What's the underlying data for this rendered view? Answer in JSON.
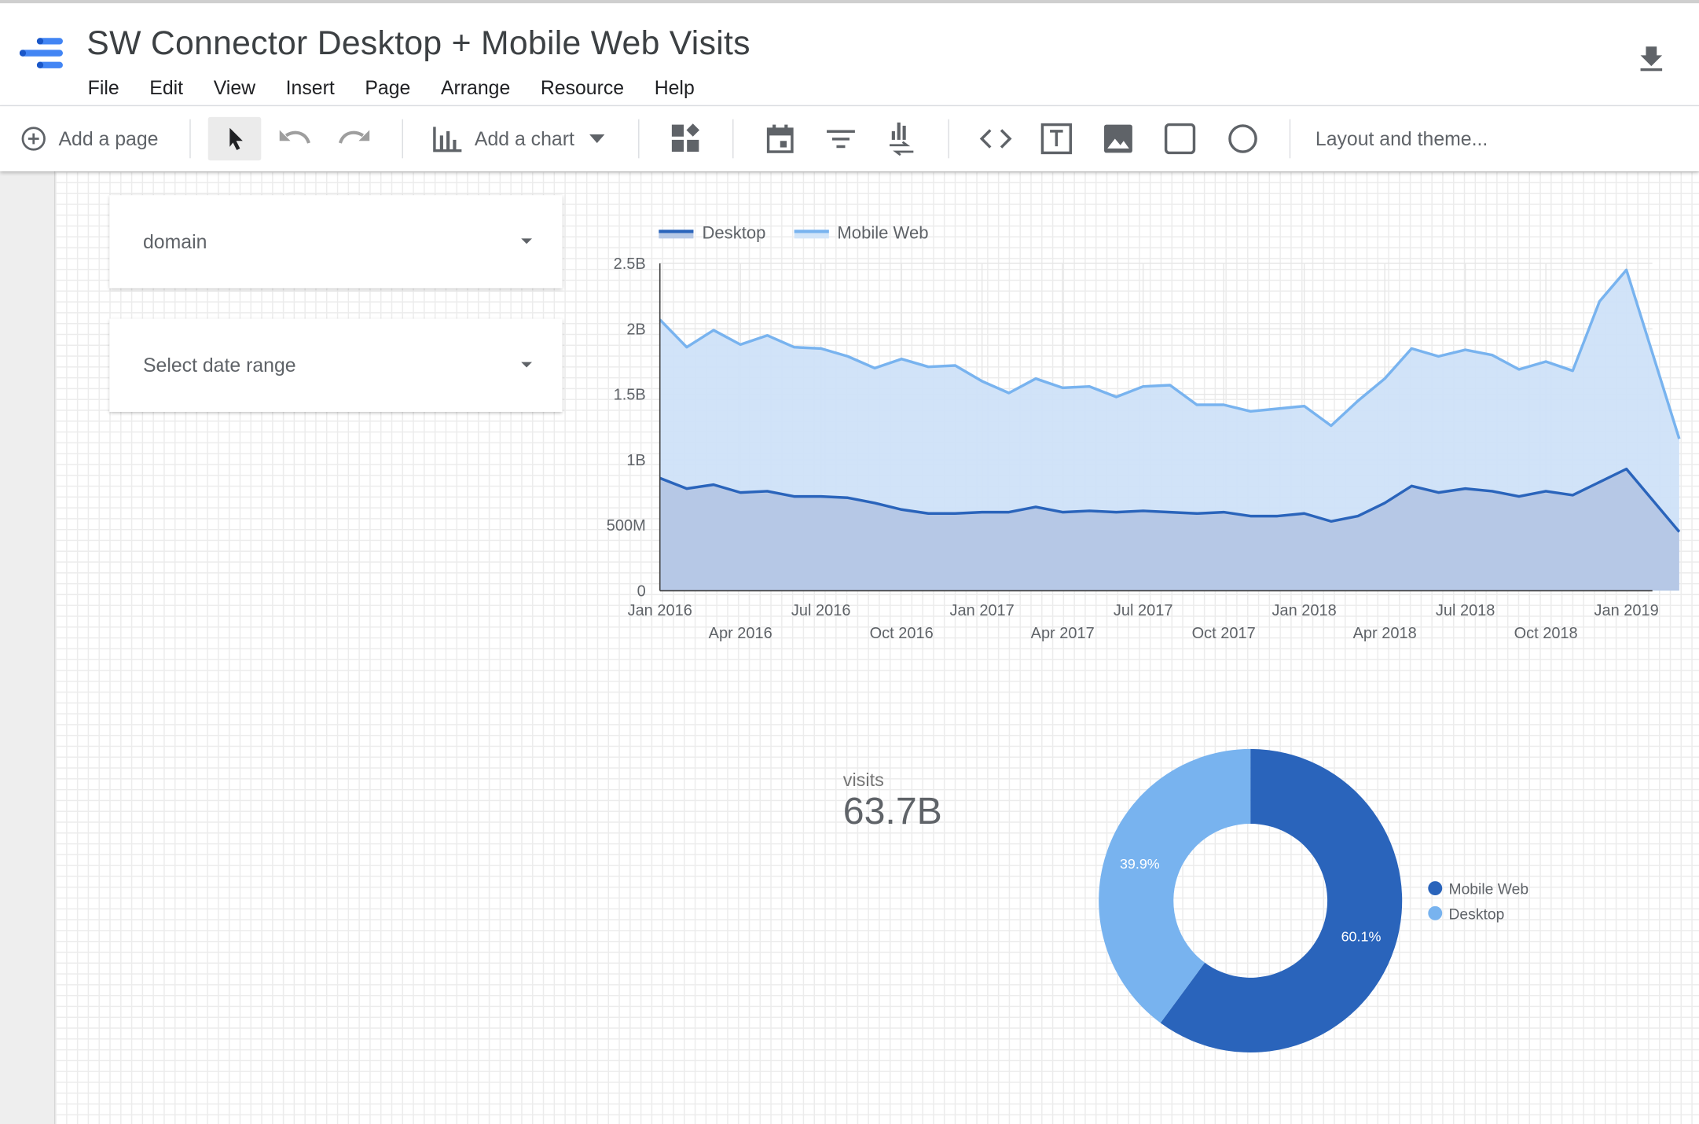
{
  "app": {
    "title": "SW Connector Desktop + Mobile Web Visits",
    "menu": [
      "File",
      "Edit",
      "View",
      "Insert",
      "Page",
      "Arrange",
      "Resource",
      "Help"
    ],
    "download_icon": "download-icon"
  },
  "toolbar": {
    "add_page_label": "Add a page",
    "add_chart_label": "Add a chart",
    "layout_theme_label": "Layout and theme...",
    "icons": [
      "add-circle-icon",
      "pointer-icon",
      "undo-icon",
      "redo-icon",
      "bar-chart-icon",
      "dropdown-arrow-icon",
      "community-viz-icon",
      "date-range-icon",
      "filter-control-icon",
      "data-control-icon",
      "embed-code-icon",
      "text-box-icon",
      "image-icon",
      "rectangle-icon",
      "circle-icon"
    ]
  },
  "controls": {
    "dimension_label": "domain",
    "date_range_label": "Select date range"
  },
  "scorecard": {
    "label": "visits",
    "value": "63.7B"
  },
  "colors": {
    "desktop": "#2a64bb",
    "mobile_web": "#78b3ef"
  },
  "chart_data": [
    {
      "type": "area",
      "legend": [
        "Desktop",
        "Mobile Web"
      ],
      "legend_position": "top-left",
      "stacked": true,
      "y_ticks": [
        "0",
        "500M",
        "1B",
        "1.5B",
        "2B",
        "2.5B"
      ],
      "y_tick_values": [
        0,
        500000000,
        1000000000,
        1500000000,
        2000000000,
        2500000000
      ],
      "ylim": [
        0,
        2500000000
      ],
      "x_start": "Jan 2016",
      "x_ticks_top": [
        "Jan 2016",
        "Jul 2016",
        "Jan 2017",
        "Jul 2017",
        "Jan 2018",
        "Jul 2018",
        "Jan 2019"
      ],
      "x_ticks_bottom": [
        "Apr 2016",
        "Oct 2016",
        "Apr 2017",
        "Oct 2017",
        "Apr 2018",
        "Oct 2018"
      ],
      "grid": true,
      "series": [
        {
          "name": "Desktop",
          "values": [
            860000000,
            780000000,
            810000000,
            750000000,
            760000000,
            720000000,
            720000000,
            710000000,
            670000000,
            620000000,
            590000000,
            590000000,
            600000000,
            600000000,
            640000000,
            600000000,
            610000000,
            600000000,
            610000000,
            600000000,
            590000000,
            600000000,
            570000000,
            570000000,
            590000000,
            530000000,
            570000000,
            670000000,
            800000000,
            750000000,
            780000000,
            760000000,
            720000000,
            760000000,
            730000000,
            830000000,
            930000000,
            450000000
          ]
        },
        {
          "name": "Mobile Web",
          "values": [
            2070000000,
            1860000000,
            1990000000,
            1880000000,
            1950000000,
            1860000000,
            1850000000,
            1790000000,
            1700000000,
            1770000000,
            1710000000,
            1720000000,
            1600000000,
            1510000000,
            1620000000,
            1550000000,
            1560000000,
            1480000000,
            1560000000,
            1570000000,
            1420000000,
            1420000000,
            1370000000,
            1390000000,
            1410000000,
            1260000000,
            1450000000,
            1620000000,
            1850000000,
            1790000000,
            1840000000,
            1800000000,
            1690000000,
            1750000000,
            1680000000,
            2210000000,
            2450000000,
            1160000000
          ]
        }
      ]
    },
    {
      "type": "pie",
      "donut": true,
      "legend_position": "right",
      "series": [
        {
          "name": "Mobile Web",
          "value": 60.1,
          "label": "60.1%"
        },
        {
          "name": "Desktop",
          "value": 39.9,
          "label": "39.9%"
        }
      ]
    }
  ]
}
